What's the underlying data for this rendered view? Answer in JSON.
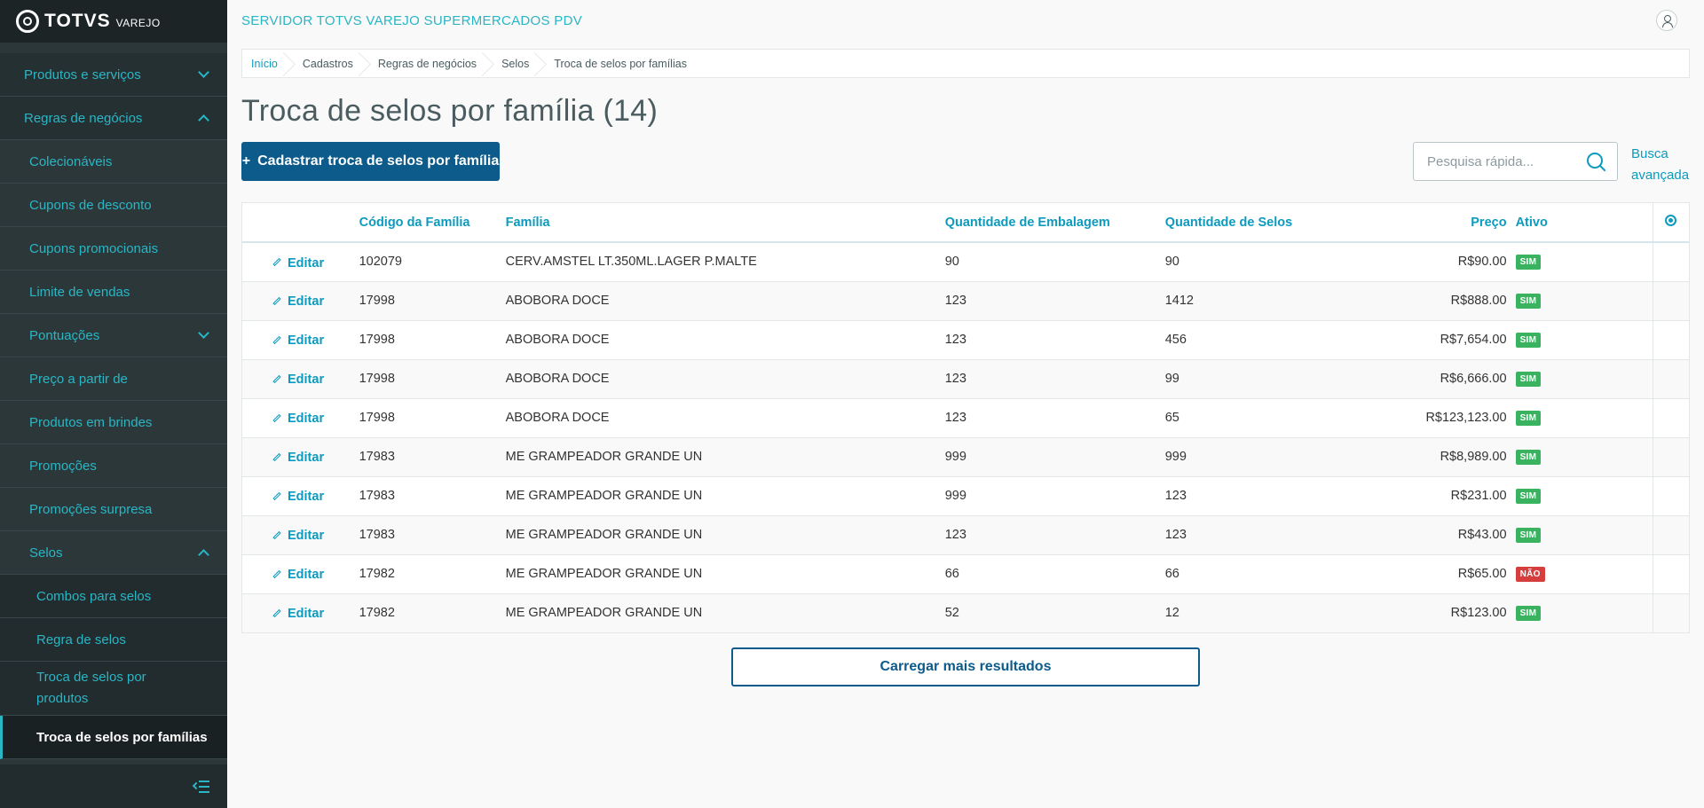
{
  "brand": {
    "name": "TOTVS",
    "sub": "VAREJO"
  },
  "header": {
    "app_title": "SERVIDOR TOTVS VAREJO SUPERMERCADOS PDV"
  },
  "sidebar": {
    "items": [
      {
        "label": "Produtos e serviços"
      },
      {
        "label": "Regras de negócios"
      },
      {
        "label": "Colecionáveis"
      },
      {
        "label": "Cupons de desconto"
      },
      {
        "label": "Cupons promocionais"
      },
      {
        "label": "Limite de vendas"
      },
      {
        "label": "Pontuações"
      },
      {
        "label": "Preço a partir de"
      },
      {
        "label": "Produtos em brindes"
      },
      {
        "label": "Promoções"
      },
      {
        "label": "Promoções surpresa"
      },
      {
        "label": "Selos"
      },
      {
        "label": "Combos para selos"
      },
      {
        "label": "Regra de selos"
      },
      {
        "label": "Troca de selos por produtos"
      },
      {
        "label": "Troca de selos por famílias"
      }
    ]
  },
  "breadcrumb": [
    "Início",
    "Cadastros",
    "Regras de negócios",
    "Selos",
    "Troca de selos por famílias"
  ],
  "page": {
    "title": "Troca de selos por família (14)",
    "add_button": "Cadastrar troca de selos por família",
    "search_placeholder": "Pesquisa rápida...",
    "advanced_search": "Busca avançada",
    "load_more": "Carregar mais resultados"
  },
  "table": {
    "columns": [
      "Código da Família",
      "Família",
      "Quantidade de Embalagem",
      "Quantidade de Selos",
      "Preço",
      "Ativo"
    ],
    "edit_label": "Editar",
    "rows": [
      {
        "code": "102079",
        "family": "CERV.AMSTEL LT.350ML.LAGER P.MALTE",
        "qty_pack": "90",
        "qty_seals": "90",
        "price": "R$90.00",
        "active": "SIM"
      },
      {
        "code": "17998",
        "family": "ABOBORA DOCE",
        "qty_pack": "123",
        "qty_seals": "1412",
        "price": "R$888.00",
        "active": "SIM"
      },
      {
        "code": "17998",
        "family": "ABOBORA DOCE",
        "qty_pack": "123",
        "qty_seals": "456",
        "price": "R$7,654.00",
        "active": "SIM"
      },
      {
        "code": "17998",
        "family": "ABOBORA DOCE",
        "qty_pack": "123",
        "qty_seals": "99",
        "price": "R$6,666.00",
        "active": "SIM"
      },
      {
        "code": "17998",
        "family": "ABOBORA DOCE",
        "qty_pack": "123",
        "qty_seals": "65",
        "price": "R$123,123.00",
        "active": "SIM"
      },
      {
        "code": "17983",
        "family": "ME GRAMPEADOR GRANDE UN",
        "qty_pack": "999",
        "qty_seals": "999",
        "price": "R$8,989.00",
        "active": "SIM"
      },
      {
        "code": "17983",
        "family": "ME GRAMPEADOR GRANDE UN",
        "qty_pack": "999",
        "qty_seals": "123",
        "price": "R$231.00",
        "active": "SIM"
      },
      {
        "code": "17983",
        "family": "ME GRAMPEADOR GRANDE UN",
        "qty_pack": "123",
        "qty_seals": "123",
        "price": "R$43.00",
        "active": "SIM"
      },
      {
        "code": "17982",
        "family": "ME GRAMPEADOR GRANDE UN",
        "qty_pack": "66",
        "qty_seals": "66",
        "price": "R$65.00",
        "active": "NÃO"
      },
      {
        "code": "17982",
        "family": "ME GRAMPEADOR GRANDE UN",
        "qty_pack": "52",
        "qty_seals": "12",
        "price": "R$123.00",
        "active": "SIM"
      }
    ]
  },
  "colors": {
    "sidebar_bg": "#2c3739",
    "accent": "#29b6c5",
    "primary_button": "#0c5b8a",
    "badge_sim": "#3ab361",
    "badge_nao": "#d63e3e"
  }
}
